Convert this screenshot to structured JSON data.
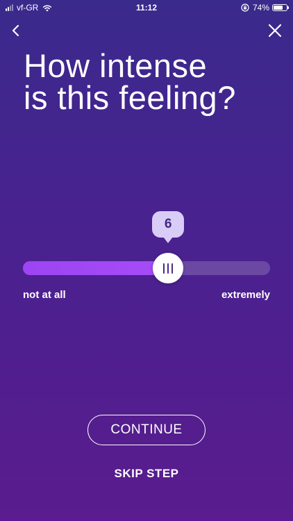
{
  "status_bar": {
    "carrier": "vf-GR",
    "time": "11:12",
    "battery_percent_text": "74%",
    "battery_level": 0.74,
    "signal_bars_active": 2,
    "signal_bars_total": 4
  },
  "nav": {
    "back_icon": "chevron-left-icon",
    "close_icon": "close-icon"
  },
  "question": {
    "line1": "How intense",
    "line2": "is this feeling?"
  },
  "slider": {
    "value": 6,
    "value_text": "6",
    "min": 0,
    "max": 10,
    "min_label": "not at all",
    "max_label": "extremely"
  },
  "actions": {
    "continue_label": "CONTINUE",
    "skip_label": "SKIP STEP"
  },
  "colors": {
    "background_top": "#3a2a8c",
    "background_bottom": "#5a1c8e",
    "slider_fill": "#9d44f4",
    "bubble": "#d9ccf7",
    "bubble_text": "#3d2a7a"
  }
}
